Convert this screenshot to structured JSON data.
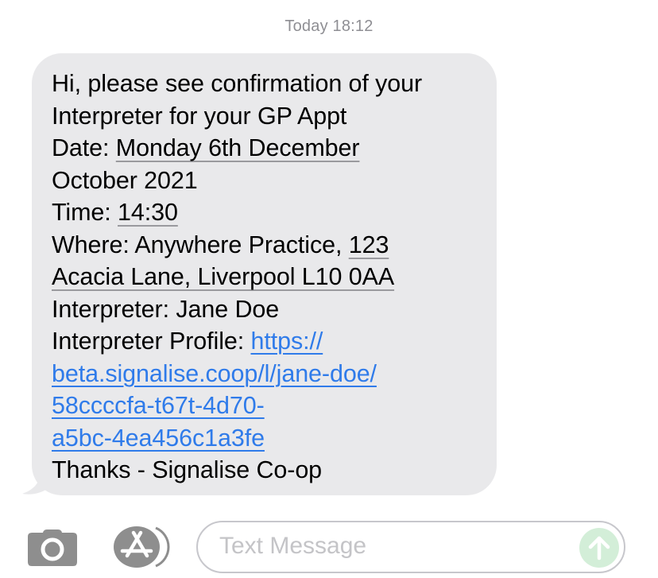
{
  "conversation": {
    "timestamp": "Today 18:12"
  },
  "message": {
    "lines": [
      {
        "text": "Hi, please see confirmation of your"
      },
      {
        "text": "Interpreter for your GP Appt"
      },
      {
        "prefix": "Date: ",
        "detected": "Monday 6th December"
      },
      {
        "text": "October 2021"
      },
      {
        "prefix": "Time: ",
        "detected": "14:30"
      },
      {
        "prefix": "Where: Anywhere Practice, ",
        "detected": "123"
      },
      {
        "detected": "Acacia Lane, Liverpool L10 0AA"
      },
      {
        "text": "Interpreter: Jane Doe"
      },
      {
        "prefix": "Interpreter Profile: ",
        "link": "https://"
      },
      {
        "link": "beta.signalise.coop/l/jane-doe/"
      },
      {
        "link": "58ccccfa-t67t-4d70-"
      },
      {
        "link": "a5bc-4ea456c1a3fe"
      },
      {
        "text": "Thanks - Signalise Co-op"
      }
    ],
    "bubble_color": "#e9e9eb",
    "link_color": "#2f7bea"
  },
  "input_bar": {
    "camera_icon": "camera-icon",
    "apps_icon": "app-store-icon",
    "placeholder": "Text Message",
    "value": "",
    "send_icon": "arrow-up-icon",
    "send_color": "#d3eed8"
  }
}
